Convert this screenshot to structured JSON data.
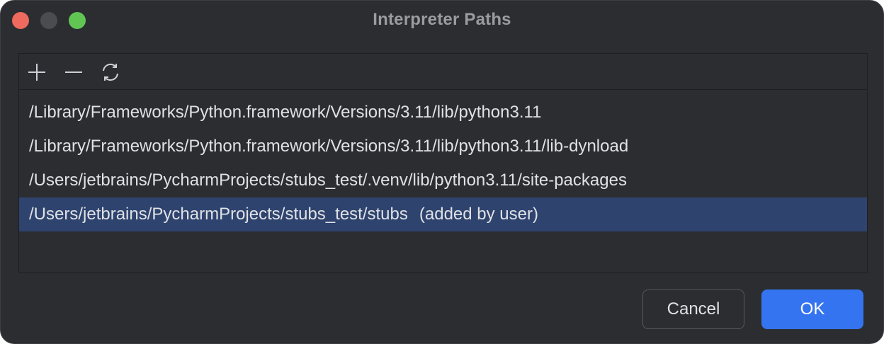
{
  "window": {
    "title": "Interpreter Paths",
    "traffic_lights": {
      "close_color": "#ee6a5e",
      "minimize_color": "#4a4c4f",
      "zoom_color": "#61c554"
    }
  },
  "toolbar": {
    "add_icon": "plus-icon",
    "remove_icon": "minus-icon",
    "reload_icon": "refresh-icon"
  },
  "paths": [
    {
      "path": "/Library/Frameworks/Python.framework/Versions/3.11/lib/python3.11",
      "note": ""
    },
    {
      "path": "/Library/Frameworks/Python.framework/Versions/3.11/lib/python3.11/lib-dynload",
      "note": ""
    },
    {
      "path": "/Users/jetbrains/PycharmProjects/stubs_test/.venv/lib/python3.11/site-packages",
      "note": ""
    },
    {
      "path": "/Users/jetbrains/PycharmProjects/stubs_test/stubs",
      "note": "(added by user)"
    }
  ],
  "selected_index": 3,
  "buttons": {
    "cancel_label": "Cancel",
    "ok_label": "OK"
  },
  "colors": {
    "accent": "#3574f0",
    "selection": "#2e436e",
    "background": "#2b2d30"
  }
}
